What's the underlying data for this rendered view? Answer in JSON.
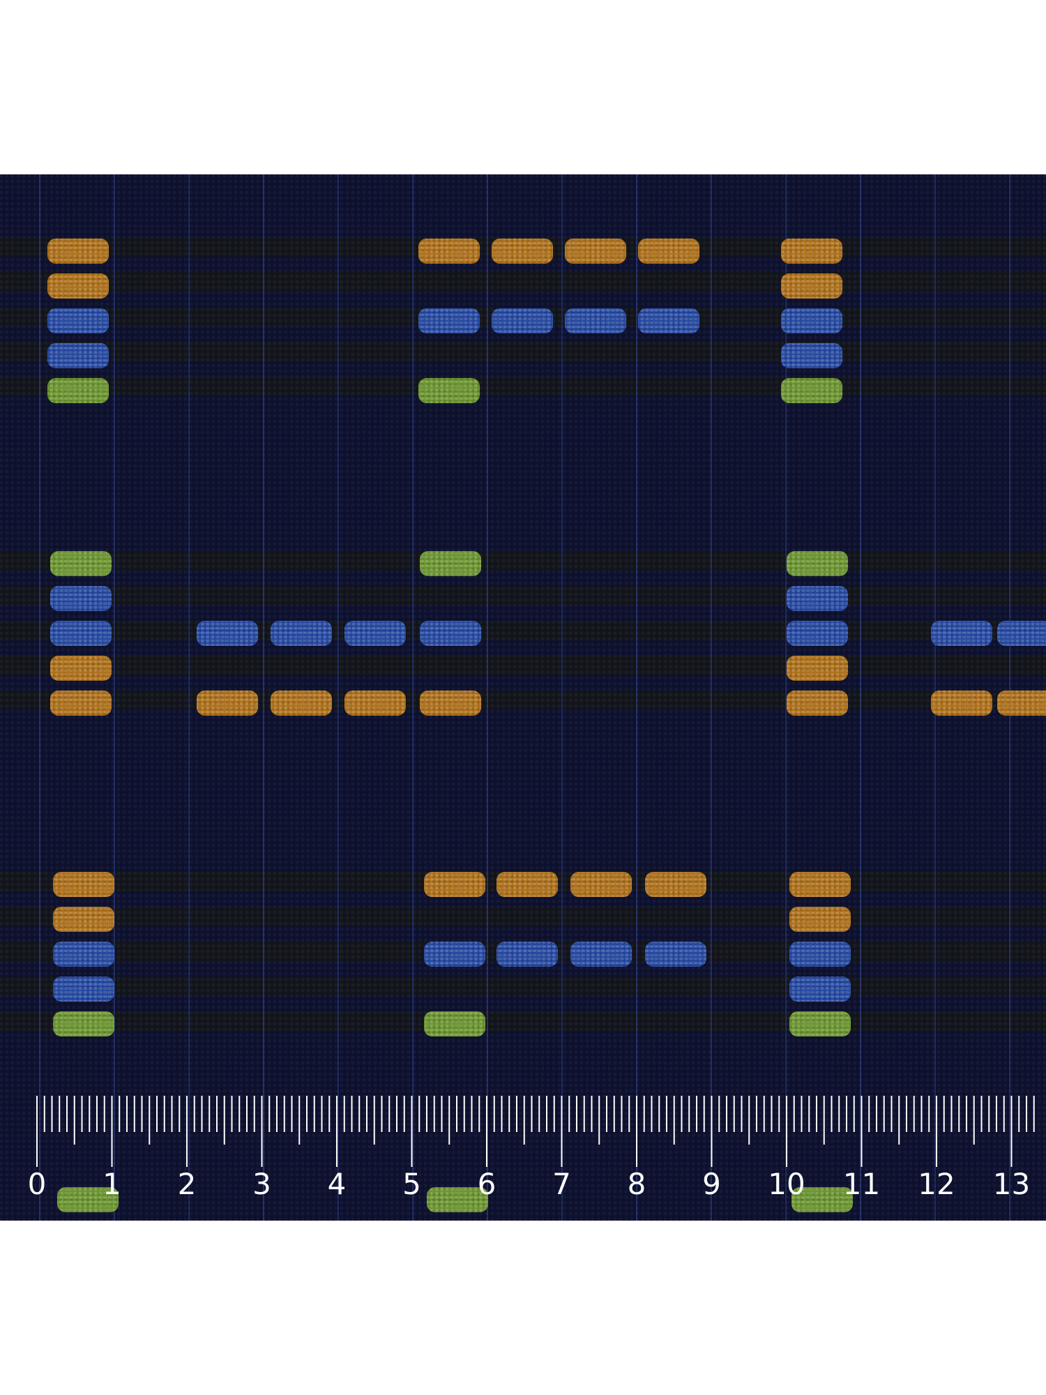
{
  "image": {
    "subject": "woven fabric swatch",
    "colors": {
      "ground": "#0e1230",
      "band": "#15171a",
      "stripe": "#2a3a7a",
      "orange": "#e6931f",
      "blue": "#2f5fd6",
      "green": "#8cc43c",
      "ruler": "#ffffff"
    }
  },
  "ruler": {
    "labels": [
      "0",
      "1",
      "2",
      "3",
      "4",
      "5",
      "6",
      "7",
      "8",
      "9",
      "10",
      "11",
      "12",
      "13"
    ]
  }
}
